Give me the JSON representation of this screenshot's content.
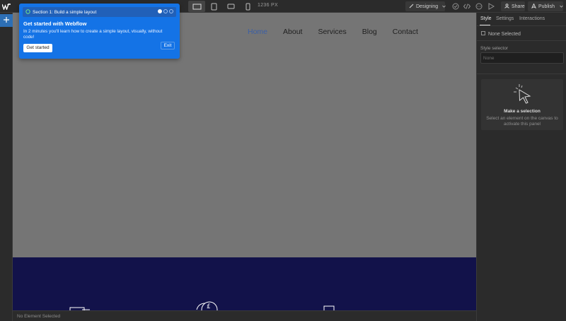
{
  "topbar": {
    "logo_icon": "webflow-logo-icon",
    "breakpoint_readout": "1236 PX",
    "mode_label": "Designing",
    "share_label": "Share",
    "publish_label": "Publish"
  },
  "canvas": {
    "nav_links": [
      "Home",
      "About",
      "Services",
      "Blog",
      "Contact"
    ],
    "active_nav": "Home"
  },
  "status_bar": {
    "text": "No Element Selected"
  },
  "right_panel": {
    "tabs": [
      "Style",
      "Settings",
      "Interactions"
    ],
    "none_selected": "None Selected",
    "style_selector_label": "Style selector",
    "style_selector_placeholder": "None",
    "empty_title": "Make a selection",
    "empty_desc": "Select an element on the canvas to activate this panel"
  },
  "onboarding": {
    "section_label": "Section 1: Build a simple layout",
    "title": "Get started with Webflow",
    "body": "In 2 minutes you'll learn how to create a simple layout, visually, without code!",
    "primary_button": "Get started",
    "exit_button": "Exit"
  },
  "colors": {
    "accent_blue": "#1473e6",
    "nav_active": "#3b5fa6",
    "footer_navy": "#12124a"
  }
}
